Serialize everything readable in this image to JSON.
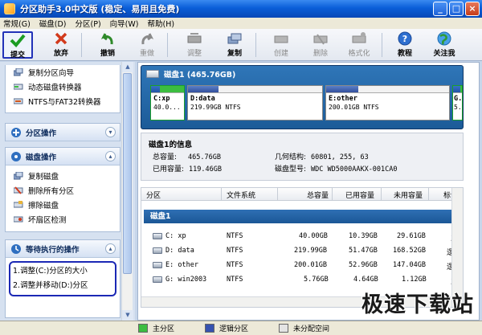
{
  "window": {
    "title": "分区助手3.0中文版 (稳定、易用且免费)",
    "buttons": [
      "_",
      "□",
      "×"
    ]
  },
  "menu": {
    "items": [
      "常规(G)",
      "磁盘(D)",
      "分区(P)",
      "向导(W)",
      "帮助(H)"
    ]
  },
  "toolbar": {
    "buttons": [
      {
        "label": "提交",
        "icon": "check-icon",
        "enabled": true,
        "selected": true
      },
      {
        "label": "放弃",
        "icon": "discard-icon",
        "enabled": true
      },
      {
        "label": "撤销",
        "icon": "undo-icon",
        "enabled": true
      },
      {
        "label": "重做",
        "icon": "redo-icon",
        "enabled": false
      },
      {
        "label": "调整",
        "icon": "resize-icon",
        "enabled": false
      },
      {
        "label": "复制",
        "icon": "copy-icon",
        "enabled": true
      },
      {
        "label": "创建",
        "icon": "create-icon",
        "enabled": false
      },
      {
        "label": "删除",
        "icon": "delete-icon",
        "enabled": false
      },
      {
        "label": "格式化",
        "icon": "format-icon",
        "enabled": false
      },
      {
        "label": "教程",
        "icon": "help-icon",
        "enabled": true
      },
      {
        "label": "关注我",
        "icon": "globe-icon",
        "enabled": true
      }
    ]
  },
  "sidebar": {
    "wizard_items": [
      "复制分区向导",
      "动态磁盘转换器",
      "NTFS与FAT32转换器"
    ],
    "partition_ops": {
      "title": "分区操作"
    },
    "disk_ops": {
      "title": "磁盘操作",
      "items": [
        "复制磁盘",
        "删除所有分区",
        "擦除磁盘",
        "坏扇区检测"
      ]
    },
    "pending": {
      "title": "等待执行的操作",
      "items": [
        "1.调整(C:)分区的大小",
        "2.调整并移动(D:)分区"
      ]
    }
  },
  "diskmap": {
    "header": "磁盘1 (465.76GB)",
    "partitions": [
      {
        "name": "C:xp",
        "info": "40.0...",
        "type": "primary",
        "used_fraction": 0.26
      },
      {
        "name": "D:data",
        "info": "219.99GB NTFS",
        "type": "logical",
        "used_fraction": 0.23
      },
      {
        "name": "E:other",
        "info": "200.01GB NTFS",
        "type": "logical",
        "used_fraction": 0.26
      },
      {
        "name": "G.",
        "info": "5...",
        "type": "primary",
        "used_fraction": 0.8
      }
    ]
  },
  "diskinfo": {
    "title": "磁盘1的信息",
    "total_label": "总容量:",
    "total_value": "465.76GB",
    "used_label": "已用容量:",
    "used_value": "119.46GB",
    "geometry_label": "几何结构:",
    "geometry_value": "60801, 255, 63",
    "model_label": "磁盘型号:",
    "model_value": "WDC WD5000AAKX-001CA0"
  },
  "table": {
    "headers": [
      "分区",
      "文件系统",
      "总容量",
      "已用容量",
      "未用容量",
      "标记"
    ],
    "disk_row": "磁盘1",
    "rows": [
      {
        "part": "C:  xp",
        "fs": "NTFS",
        "total": "40.00GB",
        "used": "10.39GB",
        "free": "29.61GB",
        "flag": "主"
      },
      {
        "part": "D:  data",
        "fs": "NTFS",
        "total": "219.99GB",
        "used": "51.47GB",
        "free": "168.52GB",
        "flag": "逻辑"
      },
      {
        "part": "E:  other",
        "fs": "NTFS",
        "total": "200.01GB",
        "used": "52.96GB",
        "free": "147.04GB",
        "flag": "逻辑"
      },
      {
        "part": "G:  win2003",
        "fs": "NTFS",
        "total": "5.76GB",
        "used": "4.64GB",
        "free": "1.12GB",
        "flag": "主"
      }
    ]
  },
  "statusbar": {
    "legend": [
      {
        "label": "主分区",
        "color": "#3cbd40"
      },
      {
        "label": "逻辑分区",
        "color": "#3552b0"
      },
      {
        "label": "未分配空间",
        "color": "#e4e4e4"
      }
    ]
  },
  "watermark": "极速下载站"
}
